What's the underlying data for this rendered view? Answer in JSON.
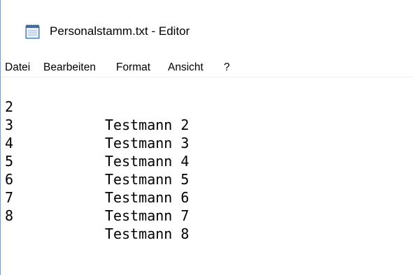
{
  "window": {
    "title": "Personalstamm.txt - Editor"
  },
  "menu": {
    "items": [
      {
        "label": "Datei"
      },
      {
        "label": "Bearbeiten"
      },
      {
        "label": "Format"
      },
      {
        "label": "Ansicht"
      },
      {
        "label": "?"
      }
    ]
  },
  "editor": {
    "lines": [
      {
        "num": "2",
        "name": "Testmann 2"
      },
      {
        "num": "3",
        "name": "Testmann 3"
      },
      {
        "num": "4",
        "name": "Testmann 4"
      },
      {
        "num": "5",
        "name": "Testmann 5"
      },
      {
        "num": "6",
        "name": "Testmann 6"
      },
      {
        "num": "7",
        "name": "Testmann 7"
      },
      {
        "num": "8",
        "name": "Testmann 8"
      }
    ]
  },
  "icons": {
    "app": "notepad-icon"
  }
}
